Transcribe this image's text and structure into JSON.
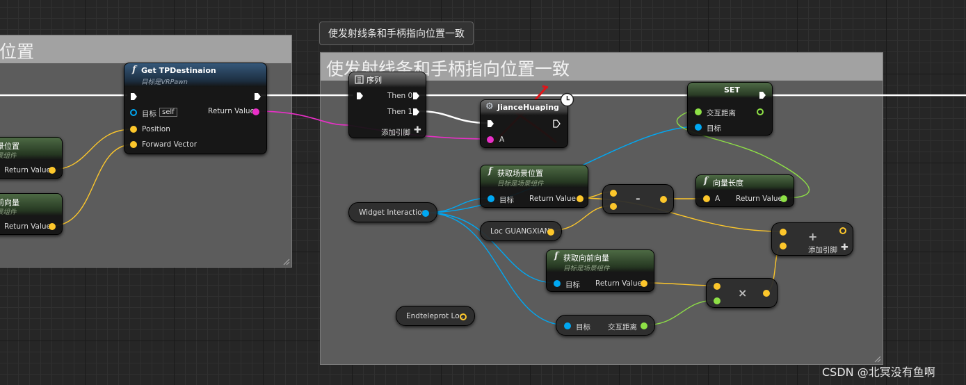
{
  "colors": {
    "exec": "#ffffff",
    "object": "#00a8f3",
    "vector": "#fdc72b",
    "float": "#8ee046",
    "pink": "#ea2fc8",
    "annotation_red": "#e0151a"
  },
  "left_comment": {
    "title": "位置"
  },
  "main_comment": {
    "bubble": "使发射线条和手柄指向位置一致",
    "title": "使发射线条和手柄指向位置一致"
  },
  "nodes": {
    "get_tp": {
      "title": "Get TPDestinaion",
      "subtitle": "目标是VRPawn",
      "target_label": "目标",
      "self": "self",
      "return_label": "Return Value",
      "position_label": "Position",
      "forward_label": "Forward Vector"
    },
    "left_loc": {
      "title": "景位置",
      "subtitle": "景组件",
      "return_label": "Return Value"
    },
    "left_fwd": {
      "title": "前向量",
      "subtitle": "景组件",
      "return_label": "Return Value"
    },
    "sequence": {
      "title": "序列",
      "then0": "Then 0",
      "then1": "Then 1",
      "add_pin": "添加引脚"
    },
    "jiance": {
      "title": "JianceHuaping",
      "a_label": "A"
    },
    "set": {
      "title": "SET",
      "distance_label": "交互距离",
      "target_label": "目标"
    },
    "get_world_loc": {
      "title": "获取场景位置",
      "subtitle": "目标是场景组件",
      "target_label": "目标",
      "return_label": "Return Value"
    },
    "subtract": {
      "symbol": "-"
    },
    "vector_length": {
      "title": "向量长度",
      "a_label": "A",
      "return_label": "Return Value"
    },
    "widget_interaction": {
      "label": "Widget Interaction"
    },
    "loc_guangxian": {
      "label": "Loc GUANGXIAN"
    },
    "add": {
      "symbol": "+",
      "add_pin": "添加引脚"
    },
    "get_forward": {
      "title": "获取向前向量",
      "subtitle": "目标是场景组件",
      "target_label": "目标",
      "return_label": "Return Value"
    },
    "multiply": {
      "symbol": "×"
    },
    "endteleport": {
      "label": "Endteleprot Loc"
    },
    "get_distance": {
      "target_label": "目标",
      "distance_label": "交互距离"
    }
  },
  "icons": {
    "function": "function-icon",
    "sequence": "sequence-icon",
    "macro": "gear-icon",
    "latent": "clock-icon",
    "plus": "plus-icon",
    "resize": "resize-grip-icon"
  },
  "watermark": "CSDN @北冥没有鱼啊"
}
